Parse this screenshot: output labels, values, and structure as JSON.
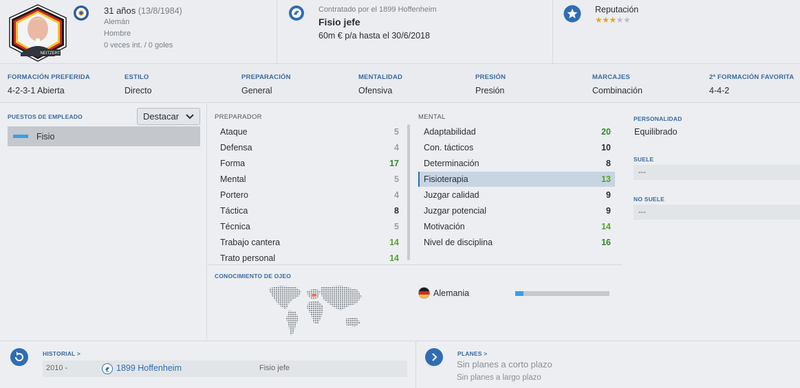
{
  "header": {
    "age": "31 años",
    "birthdate": "(13/8/1984)",
    "nationality": "Alemán",
    "gender": "Hombre",
    "intl": "0 veces int. / 0 goles",
    "photo_nameplate": "NEITZERT",
    "contract_club": "Contratado por el 1899 Hoffenheim",
    "role": "Fisio jefe",
    "wage": "60m € p/a hasta el 30/6/2018",
    "reputation_label": "Reputación",
    "reputation_stars": 3,
    "reputation_max": 5
  },
  "tactics": [
    {
      "label": "FORMACIÓN PREFERIDA",
      "value": "4-2-3-1 Abierta"
    },
    {
      "label": "ESTILO",
      "value": "Directo"
    },
    {
      "label": "PREPARACIÓN",
      "value": "General"
    },
    {
      "label": "MENTALIDAD",
      "value": "Ofensiva"
    },
    {
      "label": "PRESIÓN",
      "value": "Presión"
    },
    {
      "label": "MARCAJES",
      "value": "Combinación"
    },
    {
      "label": "2ª FORMACIÓN FAVORITA",
      "value": "4-4-2"
    }
  ],
  "positions": {
    "title": "PUESTOS DE EMPLEADO",
    "dropdown": "Destacar",
    "items": [
      "Fisio"
    ]
  },
  "coaching": {
    "title": "PREPARADOR",
    "attributes": [
      {
        "name": "Ataque",
        "value": "5"
      },
      {
        "name": "Defensa",
        "value": "4"
      },
      {
        "name": "Forma",
        "value": "17"
      },
      {
        "name": "Mental",
        "value": "5"
      },
      {
        "name": "Portero",
        "value": "4"
      },
      {
        "name": "Táctica",
        "value": "8"
      },
      {
        "name": "Técnica",
        "value": "5"
      },
      {
        "name": "Trabajo cantera",
        "value": "14"
      },
      {
        "name": "Trato personal",
        "value": "14"
      }
    ]
  },
  "mental": {
    "title": "MENTAL",
    "attributes": [
      {
        "name": "Adaptabilidad",
        "value": "20"
      },
      {
        "name": "Con. tácticos",
        "value": "10"
      },
      {
        "name": "Determinación",
        "value": "8"
      },
      {
        "name": "Fisioterapia",
        "value": "13"
      },
      {
        "name": "Juzgar calidad",
        "value": "9"
      },
      {
        "name": "Juzgar potencial",
        "value": "9"
      },
      {
        "name": "Motivación",
        "value": "14"
      },
      {
        "name": "Nivel de disciplina",
        "value": "16"
      }
    ]
  },
  "scouting": {
    "title": "CONOCIMIENTO DE OJEO",
    "country": "Alemania",
    "knowledge_fraction": 0.09
  },
  "personality": {
    "title": "PERSONALIDAD",
    "value": "Equilibrado",
    "likes_title": "SUELE",
    "likes_value": "---",
    "dislikes_title": "NO SUELE",
    "dislikes_value": "---"
  },
  "history": {
    "title": "HISTORIAL",
    "chevron": ">",
    "rows": [
      {
        "years": "2010 -",
        "club": "1899 Hoffenheim",
        "role": "Fisio jefe"
      }
    ]
  },
  "plans": {
    "title": "PLANES",
    "chevron": ">",
    "short": "Sin planes a corto plazo",
    "long": "Sin planes a largo plazo"
  },
  "colors": {
    "accent": "#2f6db3",
    "label_blue": "#3a6aa0",
    "green": "#57a32c",
    "star": "#e6a817"
  }
}
